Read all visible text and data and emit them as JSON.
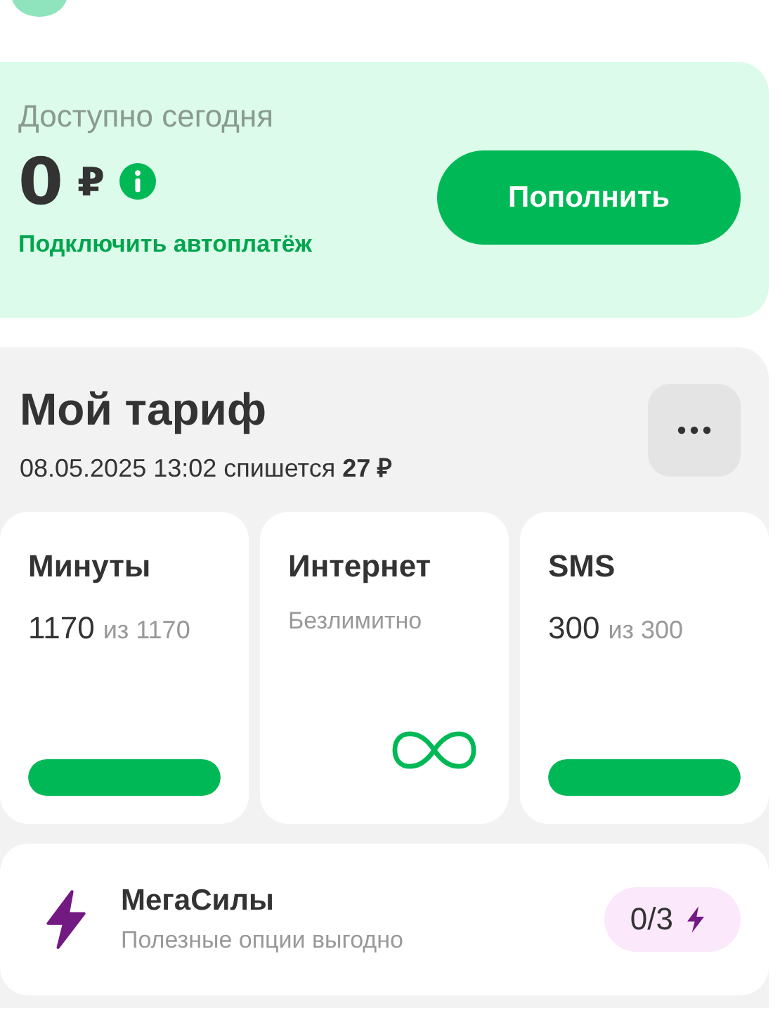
{
  "balance": {
    "label": "Доступно сегодня",
    "amount": "0",
    "currency": "₽",
    "topup_button": "Пополнить",
    "autopay_link": "Подключить автоплатёж"
  },
  "tariff": {
    "title": "Мой тариф",
    "charge_date": "08.05.2025 13:02 спишется",
    "charge_amount": "27 ₽",
    "counters": [
      {
        "kind": "meter",
        "title": "Минуты",
        "value": "1170",
        "total": "из 1170",
        "level": 1
      },
      {
        "kind": "unlimited",
        "title": "Интернет",
        "value": "Безлимитно"
      },
      {
        "kind": "meter",
        "title": "SMS",
        "value": "300",
        "total": "из 300",
        "level": 1
      }
    ]
  },
  "megasily": {
    "title": "МегаСилы",
    "subtitle": "Полезные опции выгодно",
    "count": "0/3"
  }
}
